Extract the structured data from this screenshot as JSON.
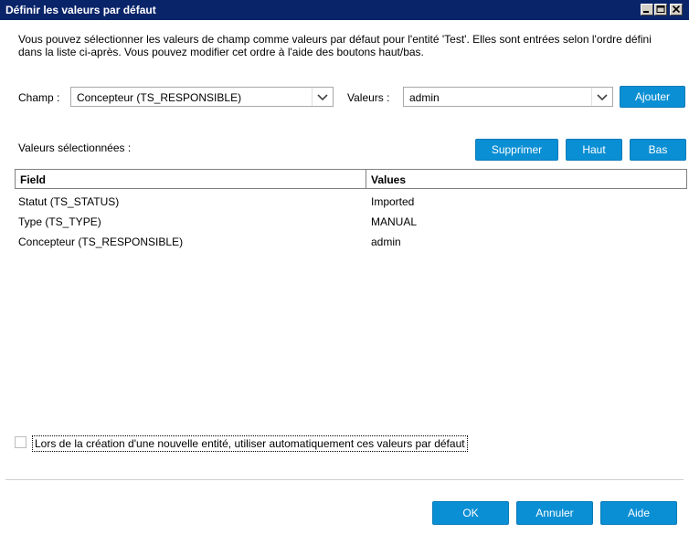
{
  "window": {
    "title": "Définir les valeurs par défaut",
    "controls": [
      "minimize-icon",
      "maximize-icon",
      "close-icon"
    ]
  },
  "intro_text": "Vous pouvez sélectionner les valeurs de champ comme valeurs par défaut pour l'entité 'Test'. Elles sont entrées selon l'ordre défini dans la liste ci-après. Vous pouvez modifier cet ordre à l'aide des boutons haut/bas.",
  "field_select": {
    "label": "Champ :",
    "value": "Concepteur (TS_RESPONSIBLE)"
  },
  "value_select": {
    "label": "Valeurs :",
    "value": "admin"
  },
  "buttons": {
    "add": "Ajouter",
    "remove": "Supprimer",
    "up": "Haut",
    "down": "Bas",
    "ok": "OK",
    "cancel": "Annuler",
    "help": "Aide"
  },
  "selected_label": "Valeurs sélectionnées :",
  "table": {
    "columns": [
      "Field",
      "Values"
    ],
    "rows": [
      {
        "field": "Statut (TS_STATUS)",
        "value": "Imported"
      },
      {
        "field": "Type (TS_TYPE)",
        "value": "MANUAL"
      },
      {
        "field": "Concepteur (TS_RESPONSIBLE)",
        "value": "admin"
      }
    ]
  },
  "auto_apply": {
    "label": "Lors de la création d'une nouvelle entité, utiliser automatiquement ces valeurs par défaut",
    "checked": false
  },
  "colors": {
    "titlebar": "#0a246a",
    "button": "#0a8fd4"
  }
}
